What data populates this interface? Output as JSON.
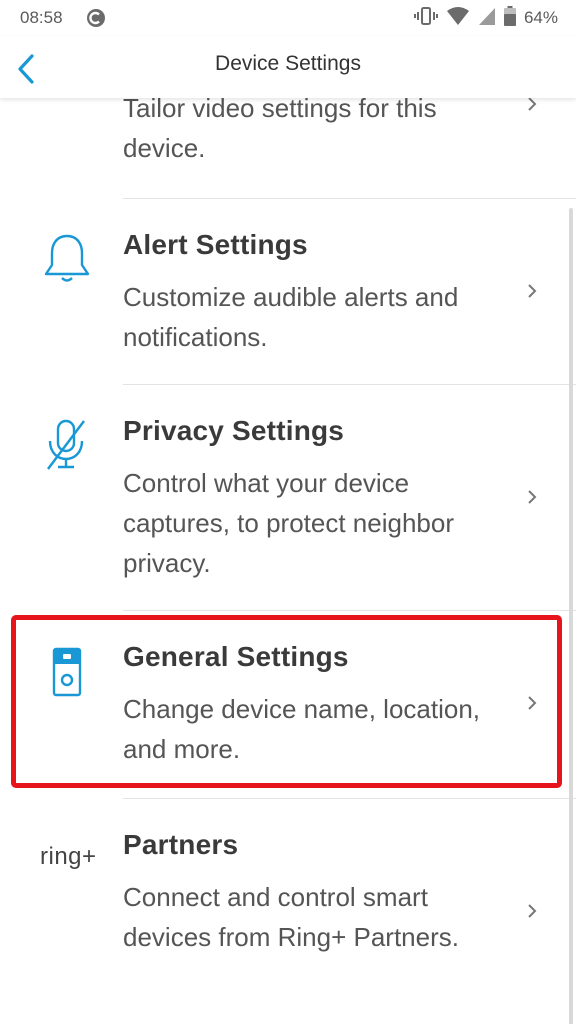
{
  "status_bar": {
    "time": "08:58",
    "battery": "64%",
    "app_icon": "ring-c-icon",
    "icons": [
      "vibrate-icon",
      "wifi-icon",
      "signal-icon",
      "battery-icon"
    ]
  },
  "header": {
    "title": "Device Settings",
    "back_icon": "chevron-left-icon"
  },
  "items": [
    {
      "id": "video",
      "title": "",
      "description": "Tailor video settings for this device.",
      "icon": "none"
    },
    {
      "id": "alert",
      "title": "Alert Settings",
      "description": "Customize audible alerts and notifications.",
      "icon": "bell-icon"
    },
    {
      "id": "privacy",
      "title": "Privacy Settings",
      "description": "Control what your device captures, to protect neighbor privacy.",
      "icon": "mic-off-icon"
    },
    {
      "id": "general",
      "title": "General Settings",
      "description": "Change device name, location, and more.",
      "icon": "doorbell-icon",
      "highlighted": true
    },
    {
      "id": "partners",
      "title": "Partners",
      "description": "Connect and control smart devices from Ring+ Partners.",
      "icon_text": "ring+"
    }
  ],
  "colors": {
    "accent": "#1998d5",
    "highlight": "#e8141c",
    "text": "#424242"
  }
}
